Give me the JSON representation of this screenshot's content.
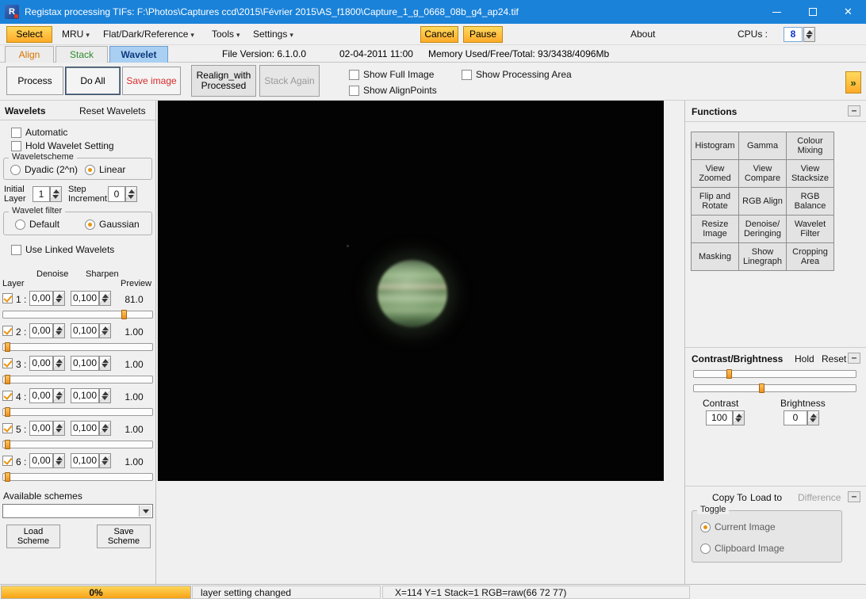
{
  "icons": {
    "app_letter": "R",
    "close": "✕",
    "caret": "▾",
    "expand": "»",
    "minus": "–"
  },
  "window": {
    "title": "Registax processing TIFs: F:\\Photos\\Captures ccd\\2015\\Février 2015\\AS_f1800\\Capture_1_g_0668_08b_g4_ap24.tif"
  },
  "menubar": {
    "select": "Select",
    "mru": "MRU",
    "flat": "Flat/Dark/Reference",
    "tools": "Tools",
    "settings": "Settings",
    "cancel": "Cancel",
    "pause": "Pause",
    "about": "About",
    "cpus_label": "CPUs :",
    "cpus_value": "8"
  },
  "tabbar": {
    "align": "Align",
    "stack": "Stack",
    "wavelet": "Wavelet",
    "file_version": "File Version: 6.1.0.0",
    "date": "02-04-2011 11:00",
    "memory": "Memory Used/Free/Total: 93/3438/4096Mb"
  },
  "toolbar": {
    "process": "Process",
    "do_all": "Do All",
    "save_image": "Save image",
    "realign": "Realign_with Processed",
    "stack_again": "Stack Again",
    "show_full_image": "Show Full Image",
    "show_alignpoints": "Show AlignPoints",
    "show_processing_area": "Show Processing Area"
  },
  "wavelets": {
    "title": "Wavelets",
    "reset": "Reset Wavelets",
    "automatic": "Automatic",
    "hold": "Hold Wavelet Setting",
    "scheme_group": "Waveletscheme",
    "dyadic": "Dyadic (2^n)",
    "linear": "Linear",
    "initial_layer": "Initial Layer",
    "initial_layer_value": "1",
    "step_increment": "Step Increment",
    "step_increment_value": "0",
    "filter_group": "Wavelet filter",
    "filter_default": "Default",
    "gaussian": "Gaussian",
    "use_linked": "Use Linked Wavelets",
    "col_layer": "Layer",
    "col_denoise": "Denoise",
    "col_sharpen": "Sharpen",
    "col_preview": "Preview",
    "layers": [
      {
        "num": "1 :",
        "denoise": "0,00",
        "sharpen": "0,100",
        "preview": "81.0",
        "slider_left": "79%"
      },
      {
        "num": "2 :",
        "denoise": "0,00",
        "sharpen": "0,100",
        "preview": "1.00",
        "slider_left": "1%"
      },
      {
        "num": "3 :",
        "denoise": "0,00",
        "sharpen": "0,100",
        "preview": "1.00",
        "slider_left": "1%"
      },
      {
        "num": "4 :",
        "denoise": "0,00",
        "sharpen": "0,100",
        "preview": "1.00",
        "slider_left": "1%"
      },
      {
        "num": "5 :",
        "denoise": "0,00",
        "sharpen": "0,100",
        "preview": "1.00",
        "slider_left": "1%"
      },
      {
        "num": "6 :",
        "denoise": "0,00",
        "sharpen": "0,100",
        "preview": "1.00",
        "slider_left": "1%"
      }
    ],
    "available_schemes": "Available schemes",
    "scheme_value": "",
    "load_scheme": "Load Scheme",
    "save_scheme": "Save Scheme"
  },
  "functions": {
    "title": "Functions",
    "buttons": [
      "Histogram",
      "Gamma",
      "Colour Mixing",
      "View Zoomed",
      "View Compare",
      "View Stacksize",
      "Flip and Rotate",
      "RGB Align",
      "RGB Balance",
      "Resize Image",
      "Denoise/ Deringing",
      "Wavelet Filter",
      "Masking",
      "Show Linegraph",
      "Cropping Area"
    ]
  },
  "contrast": {
    "title": "Contrast/Brightness",
    "hold": "Hold",
    "reset": "Reset",
    "label_contrast": "Contrast",
    "value_contrast": "100",
    "label_brightness": "Brightness",
    "value_brightness": "0",
    "slider_contrast_left": "20%",
    "slider_brightness_left": "40%"
  },
  "copy": {
    "copy_to": "Copy To",
    "load_to": "Load to",
    "difference": "Difference",
    "toggle": "Toggle",
    "current": "Current Image",
    "clipboard": "Clipboard Image"
  },
  "statusbar": {
    "progress": "0%",
    "message": "layer setting changed",
    "coords": "X=114 Y=1 Stack=1 RGB=raw(66 72 77)"
  }
}
